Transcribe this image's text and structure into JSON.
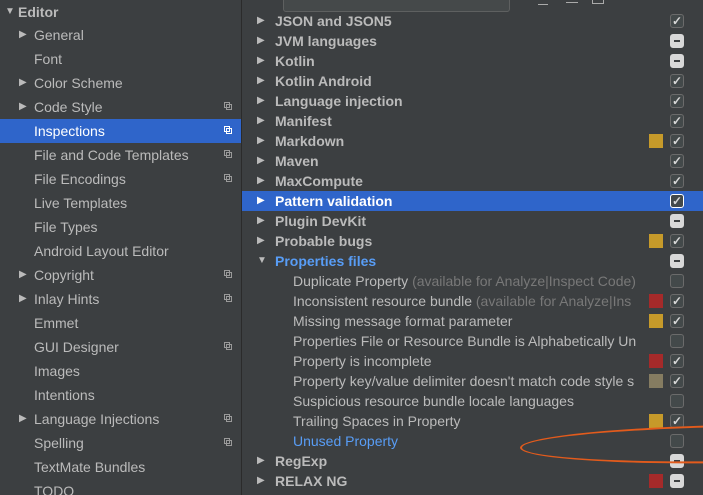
{
  "sidebar": {
    "header": "Editor",
    "items": [
      {
        "label": "General",
        "arrow": true,
        "copy": false,
        "selected": false
      },
      {
        "label": "Font",
        "arrow": false,
        "copy": false,
        "selected": false
      },
      {
        "label": "Color Scheme",
        "arrow": true,
        "copy": false,
        "selected": false
      },
      {
        "label": "Code Style",
        "arrow": true,
        "copy": true,
        "selected": false
      },
      {
        "label": "Inspections",
        "arrow": false,
        "copy": true,
        "selected": true
      },
      {
        "label": "File and Code Templates",
        "arrow": false,
        "copy": true,
        "selected": false
      },
      {
        "label": "File Encodings",
        "arrow": false,
        "copy": true,
        "selected": false
      },
      {
        "label": "Live Templates",
        "arrow": false,
        "copy": false,
        "selected": false
      },
      {
        "label": "File Types",
        "arrow": false,
        "copy": false,
        "selected": false
      },
      {
        "label": "Android Layout Editor",
        "arrow": false,
        "copy": false,
        "selected": false
      },
      {
        "label": "Copyright",
        "arrow": true,
        "copy": true,
        "selected": false
      },
      {
        "label": "Inlay Hints",
        "arrow": true,
        "copy": true,
        "selected": false
      },
      {
        "label": "Emmet",
        "arrow": false,
        "copy": false,
        "selected": false
      },
      {
        "label": "GUI Designer",
        "arrow": false,
        "copy": true,
        "selected": false
      },
      {
        "label": "Images",
        "arrow": false,
        "copy": false,
        "selected": false
      },
      {
        "label": "Intentions",
        "arrow": false,
        "copy": false,
        "selected": false
      },
      {
        "label": "Language Injections",
        "arrow": true,
        "copy": true,
        "selected": false
      },
      {
        "label": "Spelling",
        "arrow": false,
        "copy": true,
        "selected": false
      },
      {
        "label": "TextMate Bundles",
        "arrow": false,
        "copy": false,
        "selected": false
      },
      {
        "label": "TODO",
        "arrow": false,
        "copy": false,
        "selected": false
      }
    ]
  },
  "colors": {
    "weak_warning": "#c69a2a",
    "error": "#a52a2a",
    "server_problem": "#857c61",
    "selection": "#2f65ca",
    "link": "#589df6",
    "annotation": "#e35b1c"
  },
  "tree": [
    {
      "kind": "group",
      "label": "JSON and JSON5",
      "state": "checked",
      "severity": null
    },
    {
      "kind": "group",
      "label": "JVM languages",
      "state": "partial",
      "severity": null
    },
    {
      "kind": "group",
      "label": "Kotlin",
      "state": "partial",
      "severity": null
    },
    {
      "kind": "group",
      "label": "Kotlin Android",
      "state": "checked",
      "severity": null
    },
    {
      "kind": "group",
      "label": "Language injection",
      "state": "checked",
      "severity": null
    },
    {
      "kind": "group",
      "label": "Manifest",
      "state": "checked",
      "severity": null
    },
    {
      "kind": "group",
      "label": "Markdown",
      "state": "checked",
      "severity": "weak_warning"
    },
    {
      "kind": "group",
      "label": "Maven",
      "state": "checked",
      "severity": null
    },
    {
      "kind": "group",
      "label": "MaxCompute",
      "state": "checked",
      "severity": null
    },
    {
      "kind": "group",
      "label": "Pattern validation",
      "state": "checked",
      "severity": null,
      "selected": true
    },
    {
      "kind": "group",
      "label": "Plugin DevKit",
      "state": "partial",
      "severity": null
    },
    {
      "kind": "group",
      "label": "Probable bugs",
      "state": "checked",
      "severity": "weak_warning"
    },
    {
      "kind": "group",
      "label": "Properties files",
      "state": "partial",
      "severity": null,
      "expanded": true,
      "highlight": true
    },
    {
      "kind": "child",
      "label": "Duplicate Property",
      "note": "(available for Analyze|Inspect Code)",
      "state": "unchecked",
      "severity": null
    },
    {
      "kind": "child",
      "label": "Inconsistent resource bundle",
      "note": "(available for Analyze|Ins",
      "state": "checked",
      "severity": "error"
    },
    {
      "kind": "child",
      "label": "Missing message format parameter",
      "note": "",
      "state": "checked",
      "severity": "weak_warning"
    },
    {
      "kind": "child",
      "label": "Properties File or Resource Bundle is Alphabetically Un",
      "note": "",
      "state": "unchecked",
      "severity": null
    },
    {
      "kind": "child",
      "label": "Property is incomplete",
      "note": "",
      "state": "checked",
      "severity": "error"
    },
    {
      "kind": "child",
      "label": "Property key/value delimiter doesn't match code style s",
      "note": "",
      "state": "checked",
      "severity": "server_problem"
    },
    {
      "kind": "child",
      "label": "Suspicious resource bundle locale languages",
      "note": "",
      "state": "unchecked",
      "severity": null
    },
    {
      "kind": "child",
      "label": "Trailing Spaces in Property",
      "note": "",
      "state": "checked",
      "severity": "weak_warning"
    },
    {
      "kind": "child",
      "label": "Unused Property",
      "note": "",
      "state": "unchecked",
      "severity": null,
      "link": true
    },
    {
      "kind": "group",
      "label": "RegExp",
      "state": "partial",
      "severity": null
    },
    {
      "kind": "group",
      "label": "RELAX NG",
      "state": "partial",
      "severity": "error"
    }
  ]
}
